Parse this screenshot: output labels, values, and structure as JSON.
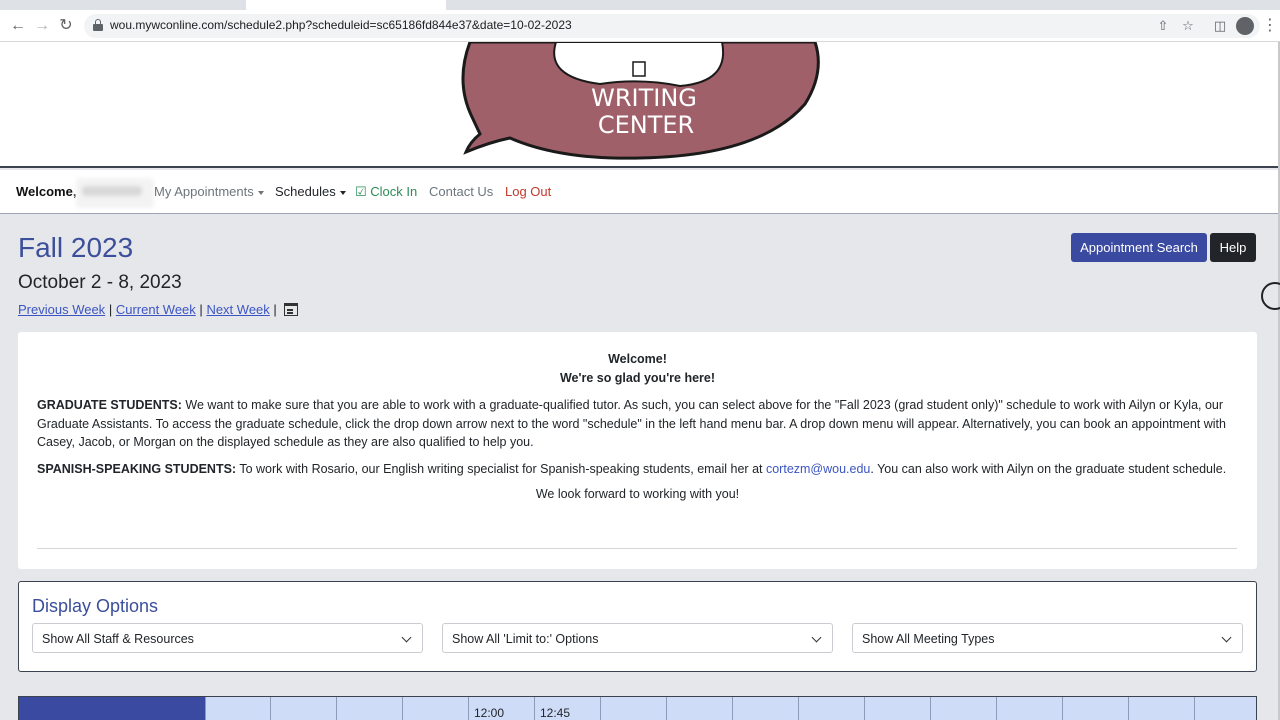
{
  "browser": {
    "url": "wou.mywconline.com/schedule2.php?scheduleid=sc65186fd844e37&date=10-02-2023",
    "icons": [
      "back-arrow-icon",
      "forward-arrow-icon",
      "reload-icon",
      "lock-icon",
      "share-icon",
      "star-icon",
      "sidepanel-icon",
      "profile-icon",
      "menu-icon"
    ]
  },
  "banner": {
    "logo_line1": "WRITING",
    "logo_line2": "CENTER",
    "logo_color": "#a0606a"
  },
  "navbar": {
    "welcome": "Welcome,",
    "items": [
      "My Appointments",
      "Schedules",
      "Clock In",
      "Contact Us",
      "Log Out"
    ],
    "clock_in_color": "#2e8b57",
    "logout_color": "#c0392b"
  },
  "schedule": {
    "title": "Fall 2023",
    "range": "October 2 - 8, 2023",
    "prev_week": "Previous Week",
    "current_week": "Current Week",
    "next_week": "Next Week",
    "separator": "|"
  },
  "actions": {
    "search": "Appointment Search",
    "help": "Help"
  },
  "welcome_card": {
    "heading1": "Welcome!",
    "heading2": "We're so glad you're here!",
    "grad_label": "GRADUATE STUDENTS:",
    "grad_text": " We want to make sure that you are able to work with a graduate-qualified tutor. As such, you can select above for the \"Fall 2023 (grad student only)\" schedule to work with Ailyn or Kyla, our Graduate Assistants. To access the graduate schedule, click the drop down arrow next to the word \"schedule\" in the left hand menu bar. A drop down menu will appear. Alternatively, you can book an appointment with Casey, Jacob, or Morgan on the displayed schedule as they are also qualified to help you.",
    "spanish_label": "SPANISH-SPEAKING STUDENTS:",
    "spanish_text1": " To work with Rosario, our English writing specialist for Spanish-speaking students, email her at ",
    "email": "cortezm@wou.edu",
    "spanish_text2": ". You can also work with Ailyn on the graduate student schedule.",
    "closing": "We look forward to working with you!"
  },
  "display_options": {
    "title": "Display Options",
    "selects": [
      "Show All Staff & Resources",
      "Show All 'Limit to:' Options",
      "Show All Meeting Types"
    ]
  },
  "grid": {
    "times": [
      "12:00",
      "12:45"
    ],
    "header_color": "#3a4aa0",
    "cell_color": "#cfdcf7"
  }
}
